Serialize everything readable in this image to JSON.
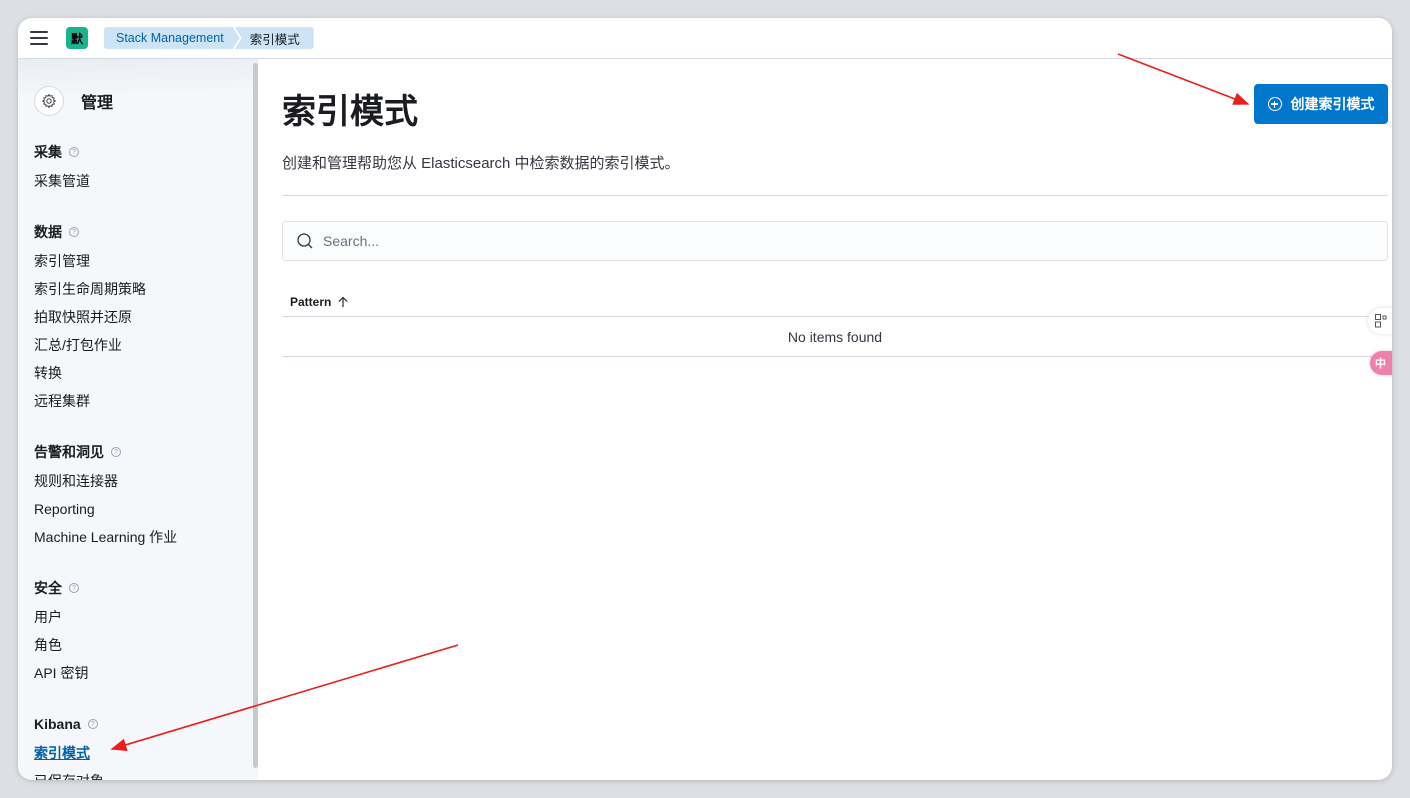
{
  "header": {
    "space_avatar": "默",
    "breadcrumbs": [
      "Stack Management",
      "索引模式"
    ]
  },
  "sidebar": {
    "title": "管理",
    "groups": [
      {
        "title": "采集",
        "items": [
          "采集管道"
        ]
      },
      {
        "title": "数据",
        "items": [
          "索引管理",
          "索引生命周期策略",
          "拍取快照并还原",
          "汇总/打包作业",
          "转换",
          "远程集群"
        ]
      },
      {
        "title": "告警和洞见",
        "items": [
          "规则和连接器",
          "Reporting",
          "Machine Learning 作业"
        ]
      },
      {
        "title": "安全",
        "items": [
          "用户",
          "角色",
          "API 密钥"
        ]
      },
      {
        "title": "Kibana",
        "items": [
          "索引模式",
          "已保存对象"
        ]
      }
    ],
    "active_item": "索引模式"
  },
  "main": {
    "title": "索引模式",
    "create_button": "创建索引模式",
    "description": "创建和管理帮助您从 Elasticsearch 中检索数据的索引模式。",
    "search_placeholder": "Search...",
    "table": {
      "column": "Pattern",
      "empty_message": "No items found"
    }
  },
  "floating": {
    "toggle_label": "中"
  },
  "colors": {
    "primary": "#0077cc",
    "breadcrumb_bg": "#cce4f5",
    "avatar": "#1bb28e",
    "annotation_arrow": "#e8201b"
  }
}
